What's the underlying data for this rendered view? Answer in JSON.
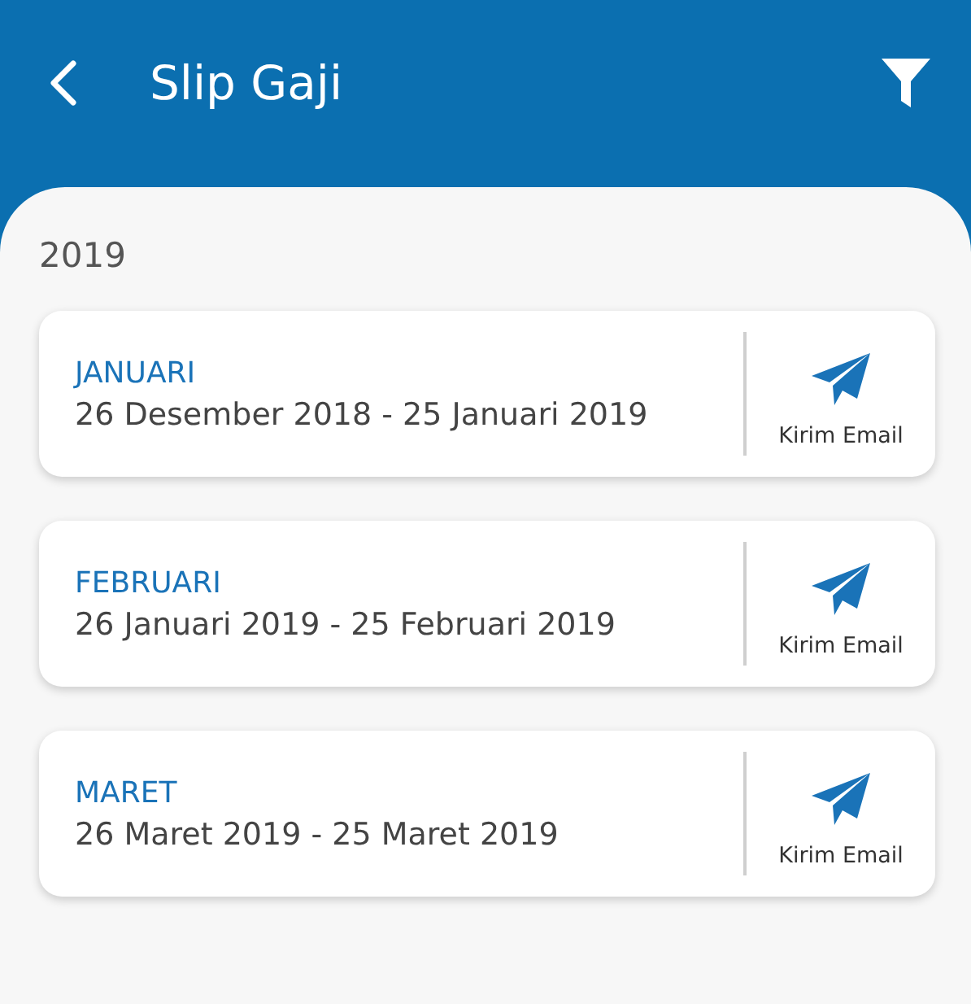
{
  "header": {
    "title": "Slip Gaji"
  },
  "year": "2019",
  "slips": [
    {
      "month": "JANUARI",
      "period": "26 Desember 2018 - 25 Januari 2019",
      "action": "Kirim Email"
    },
    {
      "month": "FEBRUARI",
      "period": "26 Januari 2019 - 25 Februari 2019",
      "action": "Kirim Email"
    },
    {
      "month": "MARET",
      "period": "26 Maret 2019 - 25 Maret 2019",
      "action": "Kirim Email"
    }
  ]
}
